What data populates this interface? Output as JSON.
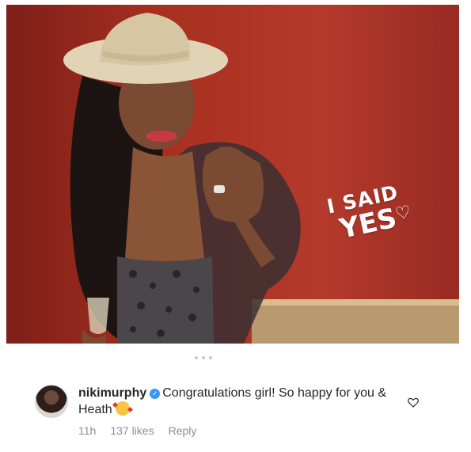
{
  "post": {
    "photo_overlay_line1": "I SAID",
    "photo_overlay_line2": "YES"
  },
  "comment": {
    "username": "nikimurphy",
    "verified": true,
    "text": "Congratulations girl!  So happy for you & Heath",
    "emoji": "smiling-face-with-hearts",
    "time": "11h",
    "likes": "137 likes",
    "reply_label": "Reply"
  },
  "colors": {
    "wall_red": "#a52d24",
    "verified_blue": "#3897f0",
    "meta_gray": "#8e8e8e",
    "text_dark": "#262626"
  }
}
